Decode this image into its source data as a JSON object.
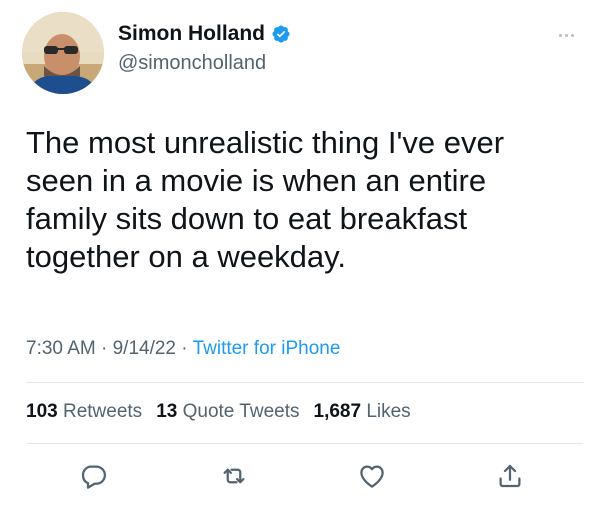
{
  "author": {
    "display_name": "Simon Holland",
    "handle": "@simoncholland",
    "verified": true,
    "avatar": "avatar-photo"
  },
  "tweet": {
    "text_lines": [
      "The most unrealistic thing I've ever",
      "seen in a movie is when an entire",
      "family sits down to eat breakfast",
      "together on a weekday."
    ],
    "time": "7:30 AM",
    "separator": "·",
    "date": "9/14/22",
    "source": "Twitter for iPhone"
  },
  "stats": {
    "retweets_count": "103",
    "retweets_label": "Retweets",
    "quotes_count": "13",
    "quotes_label": "Quote Tweets",
    "likes_count": "1,687",
    "likes_label": "Likes"
  },
  "actions": [
    "reply-icon",
    "retweet-icon",
    "like-icon",
    "share-icon"
  ],
  "colors": {
    "text_primary": "#0f1419",
    "text_secondary": "#536471",
    "link": "#1d9bf0",
    "verified": "#1d9bf0",
    "divider": "#e4e8eb"
  }
}
